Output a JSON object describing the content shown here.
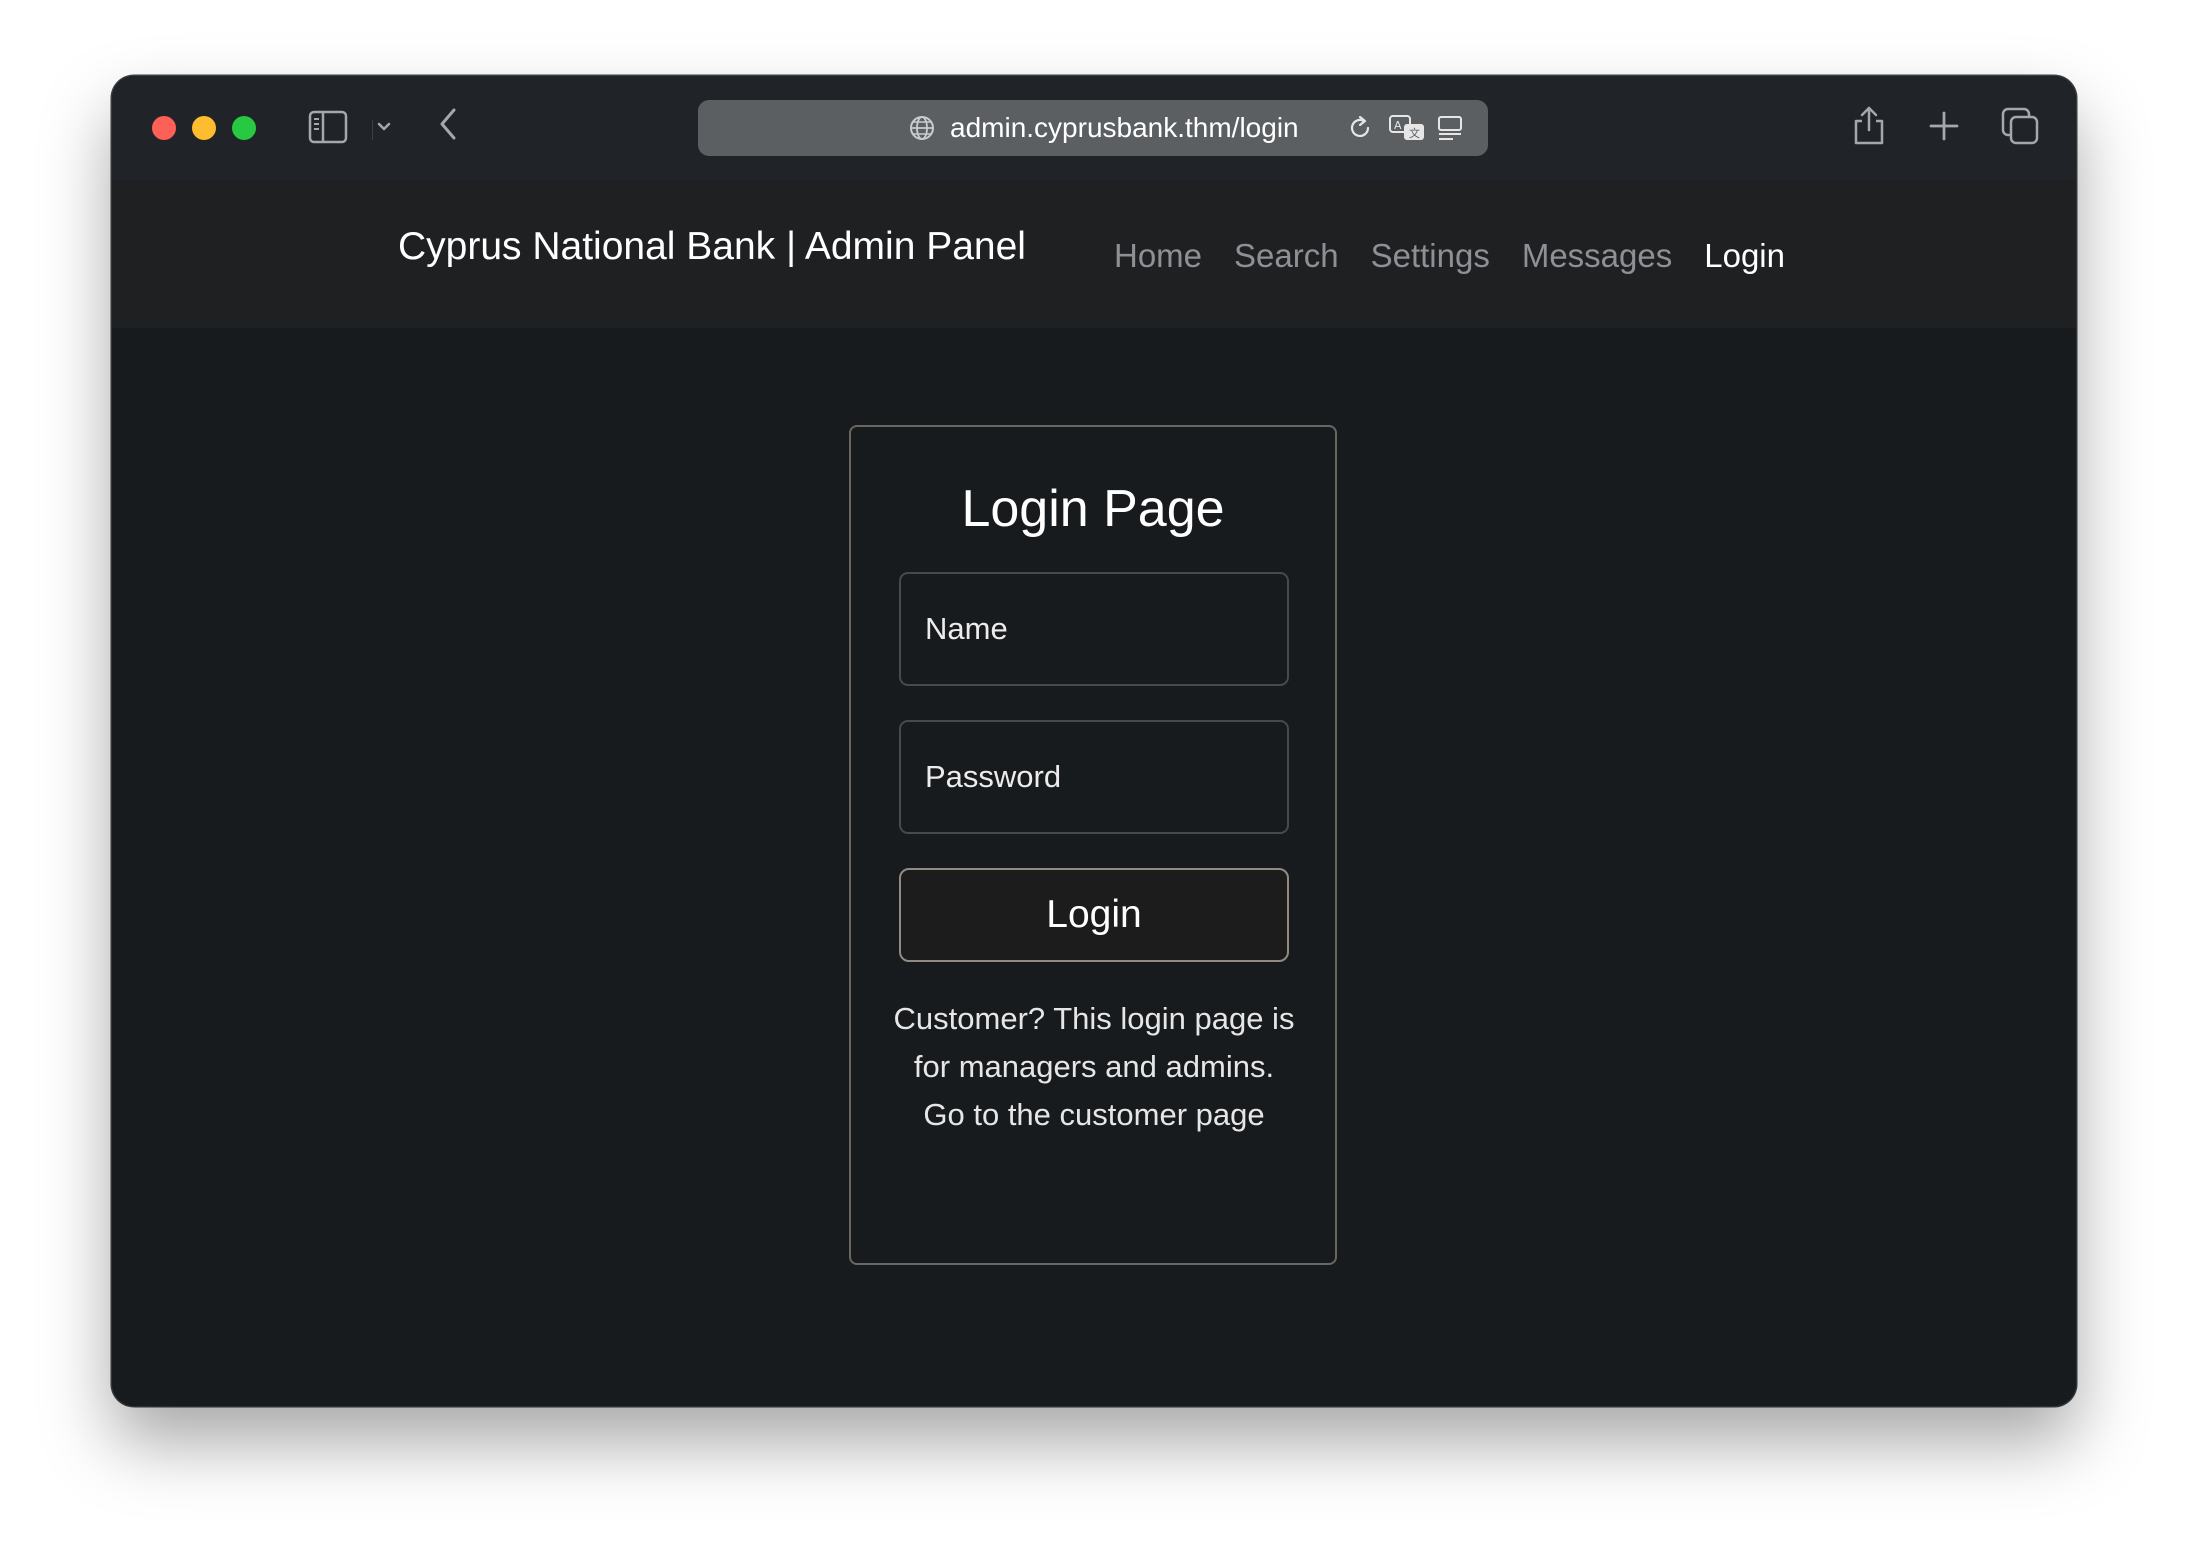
{
  "browser": {
    "url": "admin.cyprusbank.thm/login",
    "icons": {
      "window_controls": [
        "close-dot",
        "minimize-dot",
        "zoom-dot"
      ],
      "left": [
        "sidebar-icon",
        "chevron-down-icon",
        "back-chevron-icon"
      ],
      "url": [
        "globe-icon",
        "reload-icon",
        "translate-icon",
        "reader-icon"
      ],
      "right": [
        "share-icon",
        "plus-icon",
        "tabs-overview-icon"
      ]
    }
  },
  "navbar": {
    "brand": "Cyprus National Bank | Admin Panel",
    "links": [
      {
        "label": "Home",
        "active": false
      },
      {
        "label": "Search",
        "active": false
      },
      {
        "label": "Settings",
        "active": false
      },
      {
        "label": "Messages",
        "active": false
      },
      {
        "label": "Login",
        "active": true
      }
    ]
  },
  "login": {
    "title": "Login Page",
    "name_placeholder": "Name",
    "password_placeholder": "Password",
    "button_label": "Login",
    "note": "Customer? This login page is for managers and admins.",
    "customer_link": "Go to the customer page"
  },
  "colors": {
    "page_bg": "#181b1d",
    "navbar_bg": "#1f2022",
    "nav_link": "#8d9196",
    "nav_link_active": "#ffffff",
    "card_border": "#6a6660",
    "traffic_red": "#fe5f57",
    "traffic_yellow": "#febc2e",
    "traffic_green": "#28c840"
  }
}
